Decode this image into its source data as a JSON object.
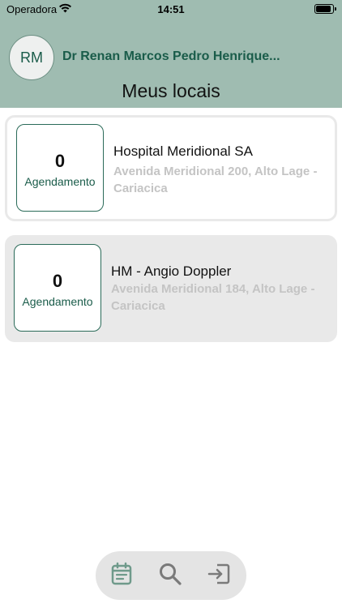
{
  "status_bar": {
    "carrier": "Operadora",
    "time": "14:51"
  },
  "header": {
    "avatar_initials": "RM",
    "doctor_name": "Dr Renan Marcos Pedro Henrique...",
    "title": "Meus locais",
    "background_color": "#9fbcb1",
    "accent_color": "#1a5c4a"
  },
  "locations": [
    {
      "count": "0",
      "count_label": "Agendamento",
      "name": "Hospital Meridional SA",
      "address": "Avenida Meridional 200, Alto Lage - Cariacica"
    },
    {
      "count": "0",
      "count_label": "Agendamento",
      "name": "HM - Angio Doppler",
      "address": "Avenida Meridional 184, Alto Lage - Cariacica"
    }
  ],
  "bottom_nav": {
    "items": [
      {
        "icon": "calendar-icon",
        "active": true
      },
      {
        "icon": "search-icon",
        "active": false
      },
      {
        "icon": "logout-icon",
        "active": false
      }
    ]
  }
}
